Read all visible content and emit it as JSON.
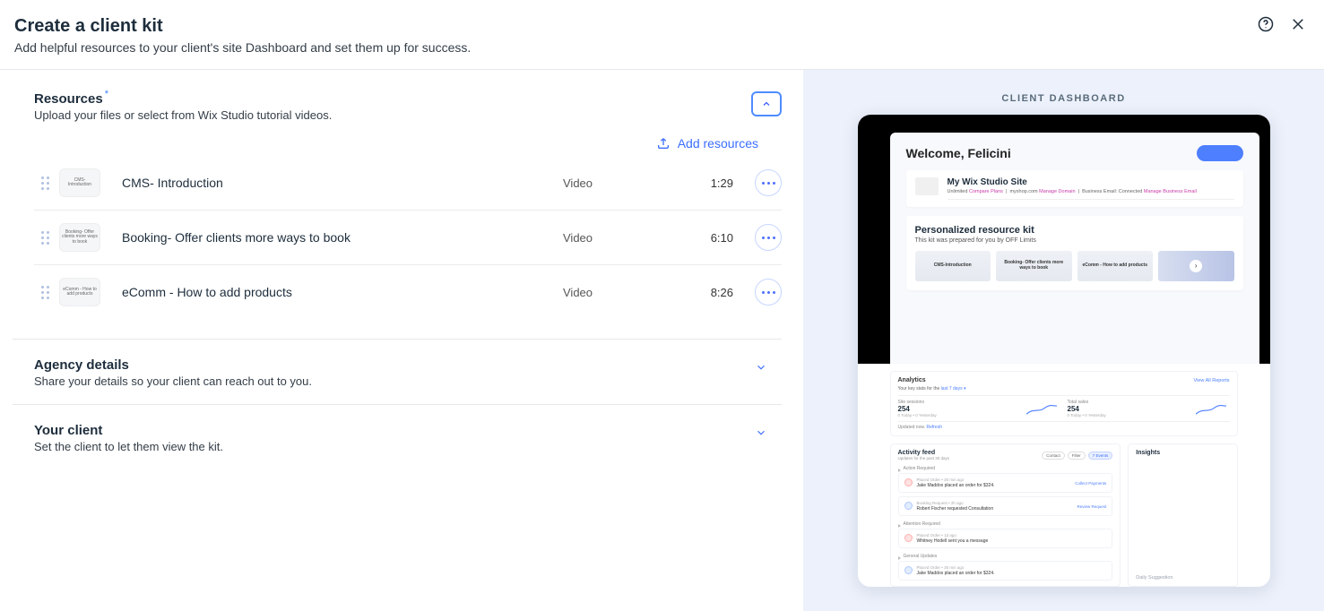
{
  "header": {
    "title": "Create a client kit",
    "subtitle": "Add helpful resources to your client's site Dashboard and set them up for success."
  },
  "resources": {
    "title": "Resources",
    "subtitle": "Upload your files or select from Wix Studio tutorial videos.",
    "add_label": "Add resources",
    "items": [
      {
        "title": "CMS- Introduction",
        "thumb": "CMS- Introduction",
        "type": "Video",
        "duration": "1:29"
      },
      {
        "title": "Booking- Offer clients more ways to book",
        "thumb": "Booking- Offer clients more ways to book",
        "type": "Video",
        "duration": "6:10"
      },
      {
        "title": "eComm - How to add products",
        "thumb": "eComm - How to add products",
        "type": "Video",
        "duration": "8:26"
      }
    ]
  },
  "agency": {
    "title": "Agency details",
    "subtitle": "Share your details so your client can reach out to you."
  },
  "client": {
    "title": "Your client",
    "subtitle": "Set the client to let them view the kit."
  },
  "preview": {
    "header": "CLIENT DASHBOARD",
    "welcome": "Welcome, Felicini",
    "site_name": "My Wix Studio Site",
    "site_meta_plan": "Unlimited",
    "site_meta_compare": "Compare Plans",
    "site_meta_domain": "myshop.com",
    "site_meta_manage_domain": "Manage Domain",
    "site_meta_email": "Business Email: Connected",
    "site_meta_manage_email": "Manage Business Email",
    "kit_title": "Personalized resource kit",
    "kit_sub": "This kit was prepared for you by OFF Limits",
    "kit_cards": [
      "CMS-Introduction",
      "Booking- Offer clients more ways to book",
      "eComm - How to add products"
    ],
    "analytics": {
      "title": "Analytics",
      "view_all": "View All Reports",
      "period_prefix": "Your key stats for the ",
      "period": "last 7 days",
      "metrics": [
        {
          "label": "Site sessions",
          "value": "254",
          "sub": "0 Today • 0 Yesterday"
        },
        {
          "label": "Total sales",
          "value": "254",
          "sub": "0 Today • 0 Yesterday"
        }
      ],
      "updated_prefix": "Updated now. ",
      "updated_link": "Refresh"
    },
    "feed": {
      "title": "Activity feed",
      "subtitle": "Updates for the past 30 days",
      "chips": [
        "Contact",
        "Filter",
        "7 Events"
      ],
      "groups": [
        {
          "label": "Action Required",
          "items": [
            {
              "meta": "Placed Order  •  30 min ago",
              "body": "Jake Maddox placed an order for $324.",
              "action": "Collect Payments",
              "icon": "red"
            },
            {
              "meta": "Booking Request  •  2h ago",
              "body": "Robert Fischer requested Consultation",
              "action": "Review Request",
              "icon": "blue"
            }
          ]
        },
        {
          "label": "Attention Required",
          "items": [
            {
              "meta": "Placed Order  •  1d ago",
              "body": "Whitney Hodell sent you a message",
              "action": "",
              "icon": "red"
            }
          ]
        },
        {
          "label": "General Updates",
          "items": [
            {
              "meta": "Placed Order  •  30 min ago",
              "body": "Jake Maddox placed an order for $324.",
              "action": "",
              "icon": "blue"
            }
          ]
        }
      ]
    },
    "insights": {
      "title": "Insights",
      "daily": "Daily Suggestion"
    }
  }
}
